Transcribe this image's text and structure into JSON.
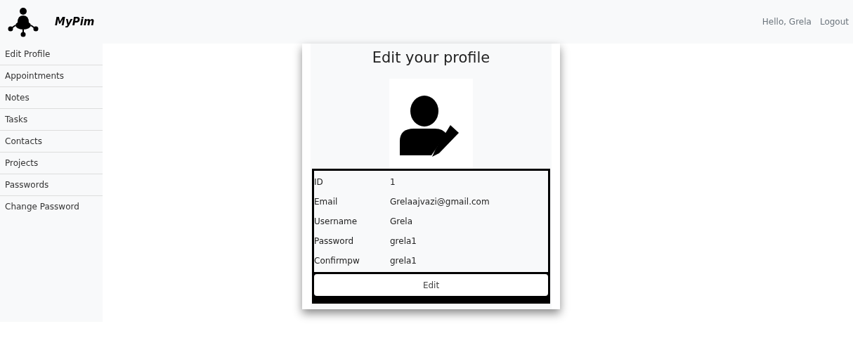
{
  "brand": {
    "name": "MyPim"
  },
  "user_nav": {
    "greeting": "Hello, Grela",
    "logout": "Logout"
  },
  "sidebar": {
    "items": [
      {
        "label": "Edit Profile"
      },
      {
        "label": "Appointments"
      },
      {
        "label": "Notes"
      },
      {
        "label": "Tasks"
      },
      {
        "label": "Contacts"
      },
      {
        "label": "Projects"
      },
      {
        "label": "Passwords"
      },
      {
        "label": "Change Password"
      }
    ]
  },
  "profile": {
    "title": "Edit your profile",
    "fields": [
      {
        "label": "ID",
        "value": "1"
      },
      {
        "label": "Email",
        "value": "Grelaajvazi@gmail.com"
      },
      {
        "label": "Username",
        "value": "Grela"
      },
      {
        "label": "Password",
        "value": "grela1"
      },
      {
        "label": "Confirmpw",
        "value": "grela1"
      }
    ],
    "button": "Edit"
  }
}
